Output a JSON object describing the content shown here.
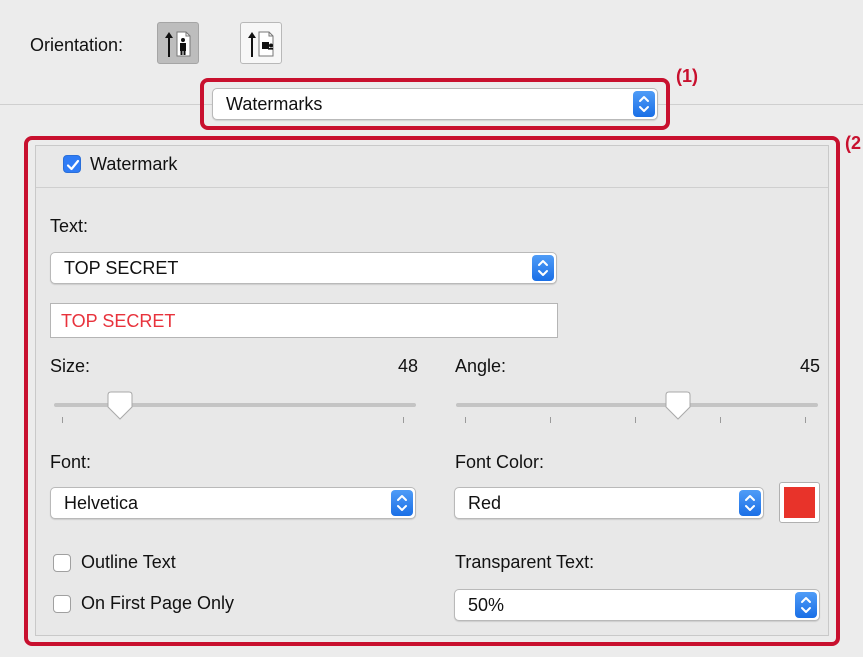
{
  "orientation": {
    "label": "Orientation:",
    "buttons": [
      {
        "name": "portrait",
        "selected": true
      },
      {
        "name": "landscape",
        "selected": false
      }
    ]
  },
  "panel_select": {
    "value": "Watermarks"
  },
  "annotations": {
    "callout_1": "(1)",
    "callout_2": "(2"
  },
  "watermark": {
    "enabled_label": "Watermark",
    "enabled": true,
    "text_label": "Text:",
    "text_preset": "TOP SECRET",
    "text_value": "TOP SECRET",
    "text_color": "#e8323c",
    "size_label": "Size:",
    "size_value": "48",
    "size_level": 0.17,
    "angle_label": "Angle:",
    "angle_value": "45",
    "angle_level": 0.625,
    "font_label": "Font:",
    "font_value": "Helvetica",
    "font_color_label": "Font Color:",
    "font_color_value": "Red",
    "font_color_swatch": "#e8332a",
    "outline_label": "Outline Text",
    "outline_checked": false,
    "first_page_label": "On First Page Only",
    "first_page_checked": false,
    "transparent_label": "Transparent Text:",
    "transparent_value": "50%"
  },
  "colors": {
    "accent": "#2f7cf6",
    "callout": "#c8102e"
  }
}
